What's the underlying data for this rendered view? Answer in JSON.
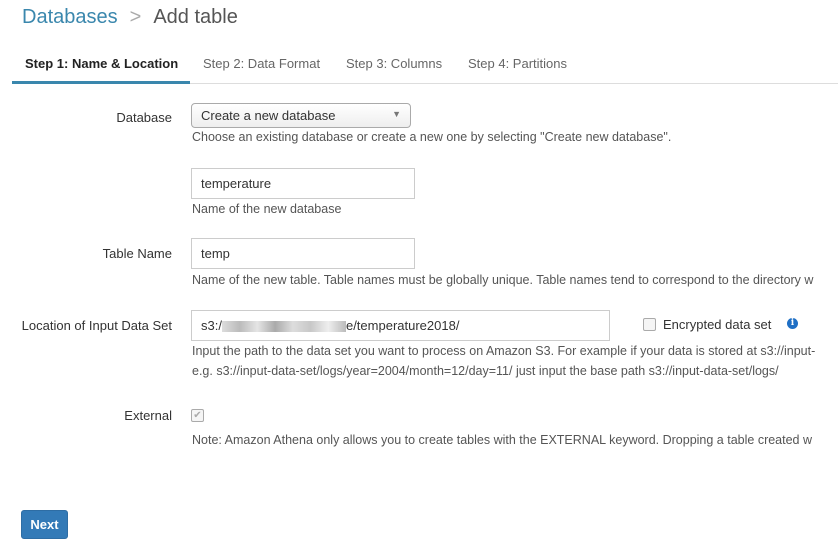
{
  "breadcrumb": {
    "parent": "Databases",
    "separator": ">",
    "current": "Add table"
  },
  "tabs": [
    {
      "label": "Step 1: Name & Location",
      "active": true
    },
    {
      "label": "Step 2: Data Format"
    },
    {
      "label": "Step 3: Columns"
    },
    {
      "label": "Step 4: Partitions"
    }
  ],
  "form": {
    "database": {
      "label": "Database",
      "selected": "Create a new database",
      "help": "Choose an existing database or create a new one by selecting \"Create new database\"."
    },
    "new_database": {
      "value": "temperature",
      "help": "Name of the new database"
    },
    "table_name": {
      "label": "Table Name",
      "value": "temp",
      "help": "Name of the new table. Table names must be globally unique. Table names tend to correspond to the directory w"
    },
    "location": {
      "label": "Location of Input Data Set",
      "value_prefix": "s3:/",
      "value_suffix": "e/temperature2018/",
      "help_line1": "Input the path to the data set you want to process on Amazon S3. For example if your data is stored at s3://input-",
      "help_line2": "e.g. s3://input-data-set/logs/year=2004/month=12/day=11/ just input the base path s3://input-data-set/logs/",
      "encrypted_label": "Encrypted data set",
      "encrypted_checked": false,
      "info_icon": "i"
    },
    "external": {
      "label": "External",
      "checked": true,
      "help": "Note: Amazon Athena only allows you to create tables with the EXTERNAL keyword. Dropping a table created w"
    }
  },
  "next_label": "Next"
}
